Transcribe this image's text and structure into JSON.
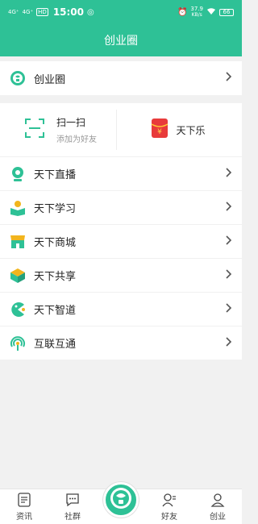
{
  "status_bar": {
    "network_left": "4G⁺",
    "network_right": "4G⁺",
    "time": "15:00",
    "speed": "37.9",
    "speed_unit": "KB/s",
    "battery": "66"
  },
  "header": {
    "title": "创业圈"
  },
  "top_row": {
    "label": "创业圈"
  },
  "scan": {
    "title": "扫一扫",
    "subtitle": "添加为好友"
  },
  "tianxia": {
    "label": "天下乐"
  },
  "menu": {
    "items": [
      {
        "label": "天下直播",
        "icon": "live-icon"
      },
      {
        "label": "天下学习",
        "icon": "study-icon"
      },
      {
        "label": "天下商城",
        "icon": "shop-icon"
      },
      {
        "label": "天下共享",
        "icon": "share-icon"
      },
      {
        "label": "天下智道",
        "icon": "smart-icon"
      },
      {
        "label": "互联互通",
        "icon": "connect-icon"
      }
    ]
  },
  "bottom_nav": {
    "items": [
      {
        "label": "资讯",
        "icon": "news-icon"
      },
      {
        "label": "社群",
        "icon": "community-icon"
      },
      {
        "label": "",
        "icon": "home-logo-icon"
      },
      {
        "label": "好友",
        "icon": "friends-icon"
      },
      {
        "label": "创业",
        "icon": "profile-icon"
      }
    ]
  },
  "colors": {
    "brand": "#2ec196",
    "red_packet": "#e83b3b"
  }
}
